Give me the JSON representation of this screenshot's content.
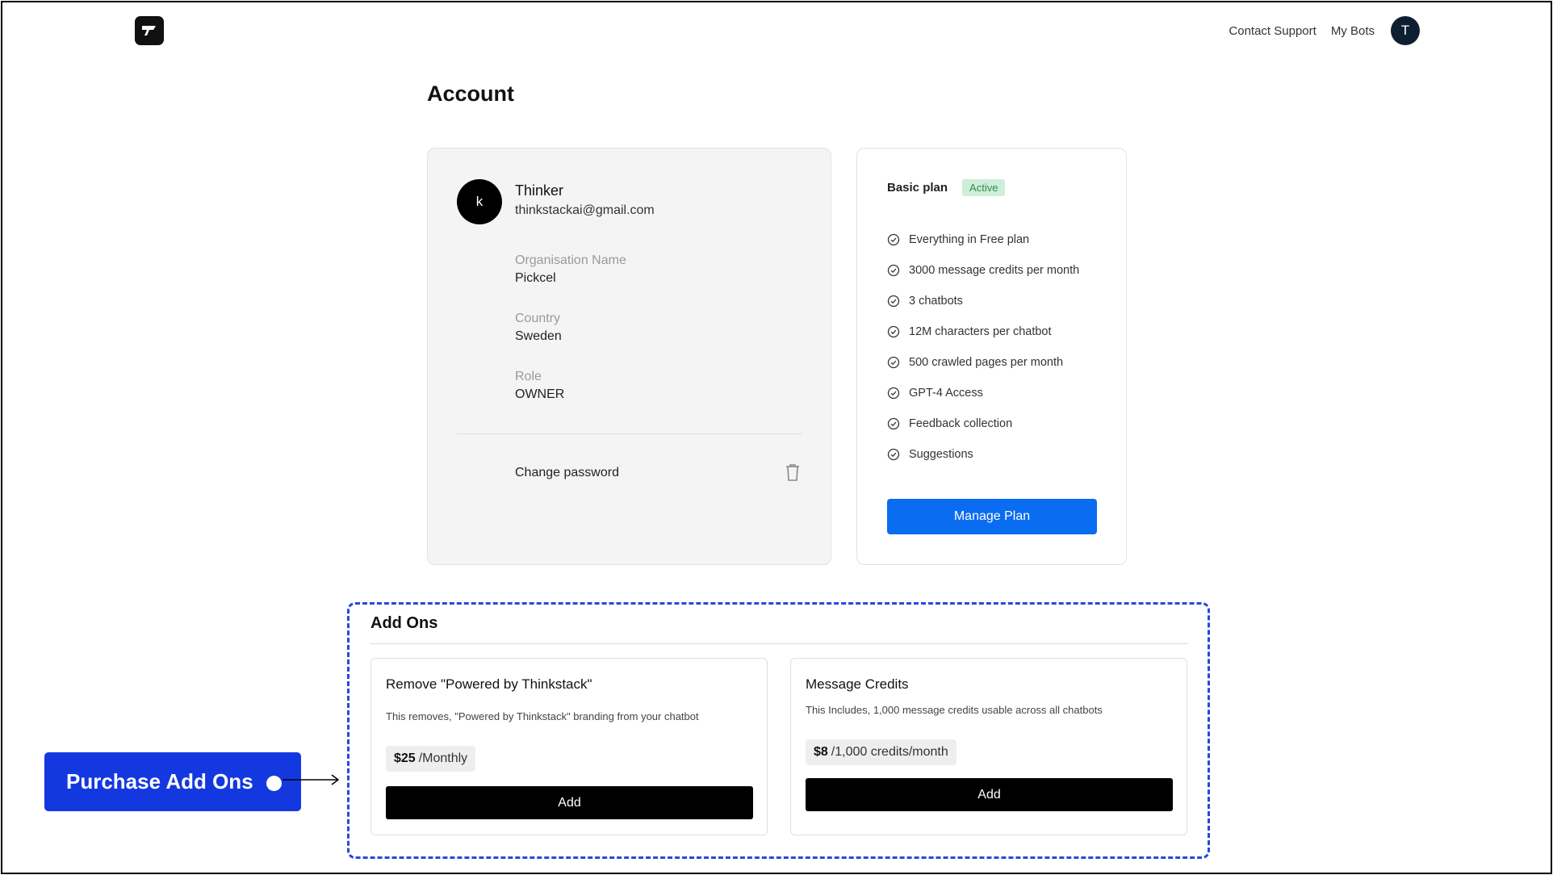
{
  "header": {
    "nav": [
      "Contact Support",
      "My Bots"
    ],
    "avatar_initial": "T"
  },
  "page": {
    "title": "Account"
  },
  "profile": {
    "avatar_initial": "k",
    "name": "Thinker",
    "email": "thinkstackai@gmail.com",
    "fields": [
      {
        "label": "Organisation Name",
        "value": "Pickcel"
      },
      {
        "label": "Country",
        "value": "Sweden"
      },
      {
        "label": "Role",
        "value": "OWNER"
      }
    ],
    "change_password": "Change password"
  },
  "plan": {
    "name": "Basic plan",
    "status": "Active",
    "features": [
      "Everything in Free plan",
      "3000 message credits per month",
      "3 chatbots",
      "12M characters per chatbot",
      "500 crawled pages per month",
      "GPT-4 Access",
      "Feedback collection",
      "Suggestions"
    ],
    "manage_label": "Manage Plan"
  },
  "addons": {
    "title": "Add Ons",
    "items": [
      {
        "title": "Remove \"Powered by Thinkstack\"",
        "description": "This removes, \"Powered by Thinkstack\" branding from your chatbot",
        "price": "$25",
        "period": "/Monthly",
        "button": "Add"
      },
      {
        "title": "Message Credits",
        "description": "This Includes, 1,000 message credits usable across all chatbots",
        "price": "$8",
        "period": "/1,000 credits/month",
        "button": "Add"
      }
    ]
  },
  "callout": {
    "text": "Purchase Add Ons"
  },
  "colors": {
    "accent_blue": "#0a6cf0",
    "callout_blue": "#1438e0",
    "active_badge_bg": "#cdeed8",
    "active_badge_text": "#2f8a4f"
  }
}
